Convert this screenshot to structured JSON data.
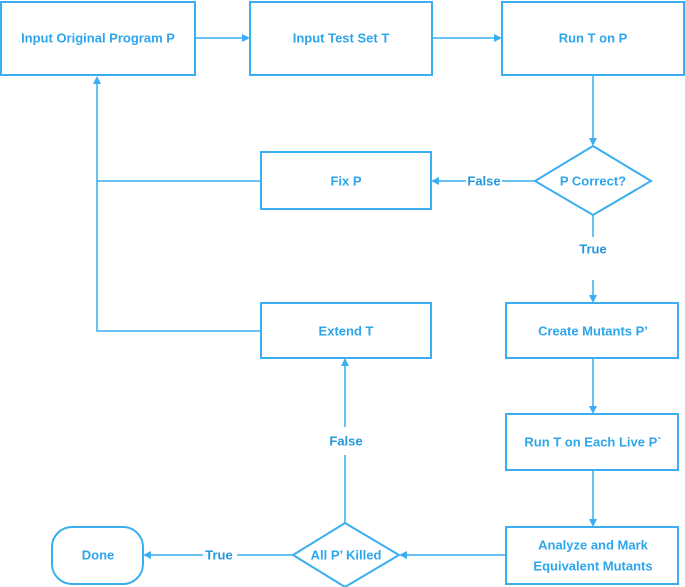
{
  "nodes": {
    "input_program": "Input Original Program P",
    "input_test_set": "Input Test Set T",
    "run_t_on_p": "Run T on P",
    "p_correct": "P Correct?",
    "fix_p": "Fix P",
    "create_mutants": "Create Mutants P’",
    "run_t_each_live": "Run T on Each Live P`",
    "analyze_line1": "Analyze and Mark",
    "analyze_line2": "Equivalent Mutants",
    "all_killed": "All P’ Killed",
    "extend_t": "Extend T",
    "done": "Done"
  },
  "edge_labels": {
    "p_correct_false": "False",
    "p_correct_true": "True",
    "all_killed_false": "False",
    "all_killed_true": "True"
  },
  "colors": {
    "stroke": "#3aaef0",
    "text": "#2ea6ec"
  }
}
